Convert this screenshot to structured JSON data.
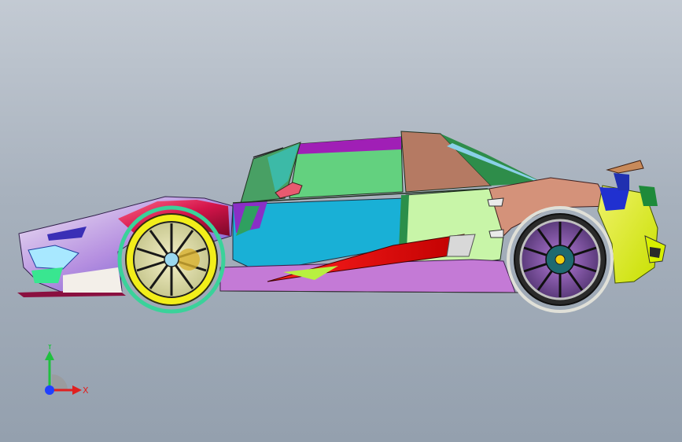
{
  "viewport": {
    "background_top": "#c3cad3",
    "background_bottom": "#94a0ae"
  },
  "triad": {
    "x_label": "X",
    "y_label": "Y",
    "x_color": "#e02020",
    "y_color": "#20c040",
    "z_color": "#2040ff"
  },
  "model": {
    "icon": "sports-car-model"
  }
}
